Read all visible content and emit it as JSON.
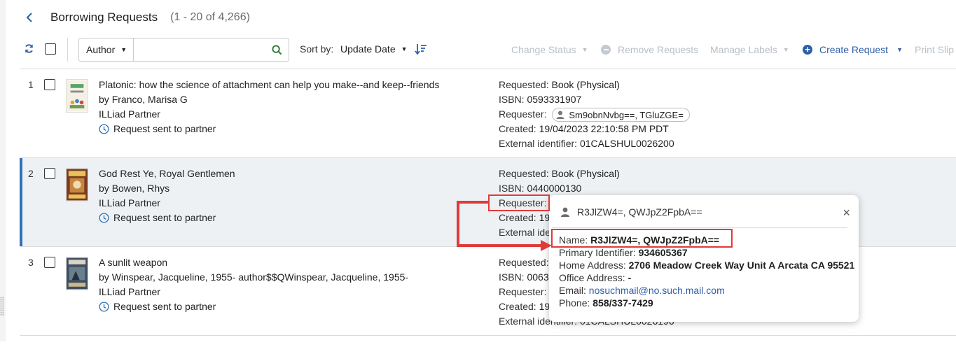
{
  "header": {
    "title": "Borrowing Requests",
    "count": "(1 - 20 of 4,266)"
  },
  "toolbar": {
    "search_field": "Author",
    "search_value": "",
    "sort_label": "Sort by:",
    "sort_value": "Update Date",
    "actions": {
      "change_status": "Change Status",
      "remove_requests": "Remove Requests",
      "manage_labels": "Manage Labels",
      "create_request": "Create Request",
      "print_slip": "Print Slip"
    }
  },
  "labels": {
    "requested": "Requested:",
    "isbn": "ISBN:",
    "requester": "Requester:",
    "created": "Created:",
    "external_identifier": "External identifier:"
  },
  "rows": [
    {
      "num": "1",
      "title": "Platonic: how the science of attachment can help you make--and keep--friends",
      "by": "by",
      "author": "Franco, Marisa G",
      "partner": "ILLiad Partner",
      "status": "Request sent to partner",
      "requested": "Book (Physical)",
      "isbn": "0593331907",
      "requester": "Sm9obnNvbg==, TGluZGE=",
      "created": "19/04/2023 22:10:58 PM PDT",
      "external_id": "01CALSHUL0026200"
    },
    {
      "num": "2",
      "title": "God Rest Ye, Royal Gentlemen",
      "by": "by",
      "author": "Bowen, Rhys",
      "partner": "ILLiad Partner",
      "status": "Request sent to partner",
      "requested": "Book (Physical)",
      "isbn": "0440000130",
      "created_partial": "19",
      "external_partial": "External ide"
    },
    {
      "num": "3",
      "title": "A sunlit weapon",
      "by": "by",
      "author": "Winspear, Jacqueline, 1955- author$$QWinspear, Jacqueline, 1955-",
      "partner": "ILLiad Partner",
      "status": "Request sent to partner",
      "isbn_partial": "0063",
      "created_partial": "19",
      "external_partial": "External identifier: 01CALSHUL0026196"
    }
  ],
  "popup": {
    "header_name": "R3JlZW4=, QWJpZ2FpbA==",
    "close": "×",
    "name_label": "Name:",
    "name_value": "R3JlZW4=, QWJpZ2FpbA==",
    "primary_label": "Primary Identifier:",
    "primary_value": "934605367",
    "home_label": "Home Address:",
    "home_value": "2706 Meadow Creek Way Unit A Arcata CA 95521",
    "office_label": "Office Address:",
    "office_value": "-",
    "email_label": "Email:",
    "email_value": "nosuchmail@no.such.mail.com",
    "phone_label": "Phone:",
    "phone_value": "858/337-7429"
  },
  "colors": {
    "accent": "#2f5fa8",
    "selected_border": "#2f72b6",
    "annotation": "#e03a3a",
    "disabled": "#b8bfc7"
  }
}
